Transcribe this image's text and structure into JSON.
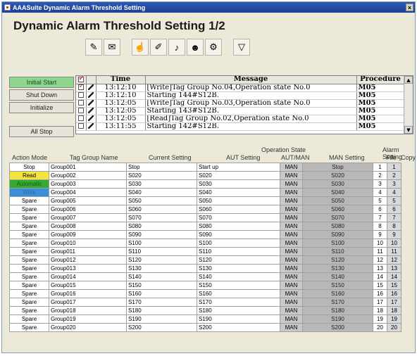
{
  "window": {
    "title": "AAASuite Dynamic Alarm Threshold Setting",
    "close": "×"
  },
  "page_title": "Dynamic Alarm Threshold Setting 1/2",
  "toolbar_icons": [
    "user-tool-icon",
    "envelope-icon",
    "hand-icon",
    "pen-tablet-icon",
    "speaker-icon",
    "operator-icon",
    "settings-icon",
    "filter-icon"
  ],
  "controls": {
    "initial_start": "Initial Start",
    "shut_down": "Shut Down",
    "initialize": "Initialize",
    "all_stop": "All Stop"
  },
  "log": {
    "headers": {
      "time": "Time",
      "message": "Message",
      "procedure": "Procedure"
    },
    "rows": [
      {
        "checked": true,
        "time": "13:12:10",
        "message": "[Write]Tag Group No.04,Operation state No.0",
        "procedure": "M05"
      },
      {
        "checked": false,
        "time": "13:12:10",
        "message": "Starting 144#S12B.",
        "procedure": "M05"
      },
      {
        "checked": false,
        "time": "13:12:05",
        "message": "[Write]Tag Group No.03,Operation state No.0",
        "procedure": "M05"
      },
      {
        "checked": false,
        "time": "13:12:05",
        "message": "Starting 143#S12B.",
        "procedure": "M05"
      },
      {
        "checked": false,
        "time": "13:12:05",
        "message": "[Read]Tag Group No.02,Operation state No.0",
        "procedure": "M05"
      },
      {
        "checked": false,
        "time": "13:11:55",
        "message": "Starting 142#S12B.",
        "procedure": "M05"
      }
    ]
  },
  "grid_headers": {
    "action_mode": "Action Mode",
    "tag_group_name": "Tag Group Name",
    "current_setting": "Current Setting",
    "operation_state": "Operation State",
    "aut_setting": "AUT Setting",
    "aut_man": "AUT/MAN",
    "man_setting": "MAN Setting",
    "alarm_setting": "Alarm Setting",
    "file": "File",
    "copy": "Copy"
  },
  "rows": [
    {
      "mode": "Stop",
      "mode_style": "stop",
      "group": "Group001",
      "current": "Stop",
      "aut": "Start up",
      "autman": "MAN",
      "man": "Stop",
      "file": "1",
      "copy": "1"
    },
    {
      "mode": "Read",
      "mode_style": "read",
      "group": "Group002",
      "current": "S020",
      "aut": "S020",
      "autman": "MAN",
      "man": "S020",
      "file": "2",
      "copy": "2"
    },
    {
      "mode": "Automatic",
      "mode_style": "green",
      "group": "Group003",
      "current": "S030",
      "aut": "S030",
      "autman": "MAN",
      "man": "S030",
      "file": "3",
      "copy": "3"
    },
    {
      "mode": "Write",
      "mode_style": "blue",
      "group": "Group004",
      "current": "S040",
      "aut": "S040",
      "autman": "MAN",
      "man": "S040",
      "file": "4",
      "copy": "4"
    },
    {
      "mode": "Spare",
      "mode_style": "stop",
      "group": "Group005",
      "current": "S050",
      "aut": "S050",
      "autman": "MAN",
      "man": "S050",
      "file": "5",
      "copy": "5"
    },
    {
      "mode": "Spare",
      "mode_style": "stop",
      "group": "Group006",
      "current": "S060",
      "aut": "S060",
      "autman": "MAN",
      "man": "S060",
      "file": "6",
      "copy": "6"
    },
    {
      "mode": "Spare",
      "mode_style": "stop",
      "group": "Group007",
      "current": "S070",
      "aut": "S070",
      "autman": "MAN",
      "man": "S070",
      "file": "7",
      "copy": "7"
    },
    {
      "mode": "Spare",
      "mode_style": "stop",
      "group": "Group008",
      "current": "S080",
      "aut": "S080",
      "autman": "MAN",
      "man": "S080",
      "file": "8",
      "copy": "8"
    },
    {
      "mode": "Spare",
      "mode_style": "stop",
      "group": "Group009",
      "current": "S090",
      "aut": "S090",
      "autman": "MAN",
      "man": "S090",
      "file": "9",
      "copy": "9"
    },
    {
      "mode": "Spare",
      "mode_style": "stop",
      "group": "Group010",
      "current": "S100",
      "aut": "S100",
      "autman": "MAN",
      "man": "S100",
      "file": "10",
      "copy": "10"
    },
    {
      "mode": "Spare",
      "mode_style": "stop",
      "group": "Group011",
      "current": "S110",
      "aut": "S110",
      "autman": "MAN",
      "man": "S110",
      "file": "11",
      "copy": "11"
    },
    {
      "mode": "Spare",
      "mode_style": "stop",
      "group": "Group012",
      "current": "S120",
      "aut": "S120",
      "autman": "MAN",
      "man": "S120",
      "file": "12",
      "copy": "12"
    },
    {
      "mode": "Spare",
      "mode_style": "stop",
      "group": "Group013",
      "current": "S130",
      "aut": "S130",
      "autman": "MAN",
      "man": "S130",
      "file": "13",
      "copy": "13"
    },
    {
      "mode": "Spare",
      "mode_style": "stop",
      "group": "Group014",
      "current": "S140",
      "aut": "S140",
      "autman": "MAN",
      "man": "S140",
      "file": "14",
      "copy": "14"
    },
    {
      "mode": "Spare",
      "mode_style": "stop",
      "group": "Group015",
      "current": "S150",
      "aut": "S150",
      "autman": "MAN",
      "man": "S150",
      "file": "15",
      "copy": "15"
    },
    {
      "mode": "Spare",
      "mode_style": "stop",
      "group": "Group016",
      "current": "S160",
      "aut": "S160",
      "autman": "MAN",
      "man": "S160",
      "file": "16",
      "copy": "16"
    },
    {
      "mode": "Spare",
      "mode_style": "stop",
      "group": "Group017",
      "current": "S170",
      "aut": "S170",
      "autman": "MAN",
      "man": "S170",
      "file": "17",
      "copy": "17"
    },
    {
      "mode": "Spare",
      "mode_style": "stop",
      "group": "Group018",
      "current": "S180",
      "aut": "S180",
      "autman": "MAN",
      "man": "S180",
      "file": "18",
      "copy": "18"
    },
    {
      "mode": "Spare",
      "mode_style": "stop",
      "group": "Group019",
      "current": "S190",
      "aut": "S190",
      "autman": "MAN",
      "man": "S190",
      "file": "19",
      "copy": "19"
    },
    {
      "mode": "Spare",
      "mode_style": "stop",
      "group": "Group020",
      "current": "S200",
      "aut": "S200",
      "autman": "MAN",
      "man": "S200",
      "file": "20",
      "copy": "20"
    }
  ]
}
